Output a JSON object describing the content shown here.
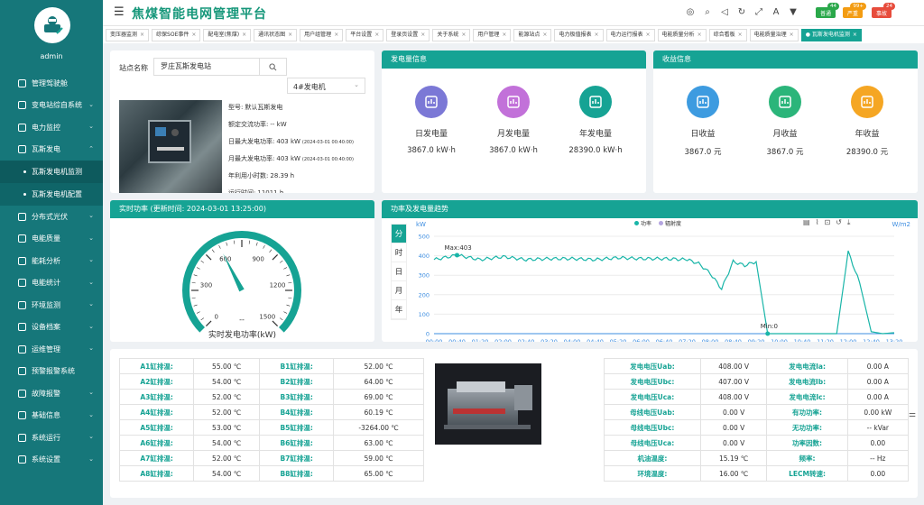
{
  "app": {
    "title": "焦煤智能电网管理平台",
    "user": "admin"
  },
  "sidebar": {
    "items": [
      {
        "label": "管理驾驶舱",
        "icon": "monitor-icon",
        "arrow": false
      },
      {
        "label": "变电站综自系统",
        "icon": "house-icon",
        "arrow": true
      },
      {
        "label": "电力监控",
        "icon": "gauge-icon",
        "arrow": true
      },
      {
        "label": "瓦斯发电",
        "icon": "gas-icon",
        "arrow": true,
        "open": true
      },
      {
        "label": "分布式光伏",
        "icon": "solar-icon",
        "arrow": true
      },
      {
        "label": "电能质量",
        "icon": "quality-icon",
        "arrow": true
      },
      {
        "label": "能耗分析",
        "icon": "chart-icon",
        "arrow": true
      },
      {
        "label": "电能统计",
        "icon": "stats-icon",
        "arrow": true
      },
      {
        "label": "环境监测",
        "icon": "env-icon",
        "arrow": true
      },
      {
        "label": "设备档案",
        "icon": "archive-icon",
        "arrow": true
      },
      {
        "label": "运维管理",
        "icon": "tools-icon",
        "arrow": true
      },
      {
        "label": "预警报警系统",
        "icon": "alarm-icon",
        "arrow": false
      },
      {
        "label": "故障报警",
        "icon": "fault-icon",
        "arrow": true
      },
      {
        "label": "基础信息",
        "icon": "info-icon",
        "arrow": true
      },
      {
        "label": "系统运行",
        "icon": "run-icon",
        "arrow": true
      },
      {
        "label": "系统设置",
        "icon": "settings-icon",
        "arrow": true
      }
    ],
    "sub_items": [
      {
        "label": "瓦斯发电机监测"
      },
      {
        "label": "瓦斯发电机配置"
      }
    ]
  },
  "topbar": {
    "icons": [
      "lifebuoy-icon",
      "search-icon",
      "volume-icon",
      "refresh-icon",
      "fullscreen-icon",
      "font-icon",
      "shirt-icon"
    ],
    "badges": [
      {
        "label": "普通",
        "count": "44",
        "color": "#2aa84a"
      },
      {
        "label": "严重",
        "count": "99+",
        "color": "#f39c12"
      },
      {
        "label": "事故",
        "count": "24",
        "color": "#e74c3c"
      }
    ]
  },
  "tabs": [
    "变压器监测",
    "综保SOE事件",
    "配电室(焦煤)",
    "通讯状态图",
    "用户组管理",
    "平台设置",
    "登录页设置",
    "关于系统",
    "用户管理",
    "能源站点",
    "电力极值报表",
    "电力运行报表",
    "电能质量分析",
    "综合看板",
    "电能质量治理",
    "瓦斯发电机监测"
  ],
  "station": {
    "label": "站点名称",
    "value": "罗庄瓦斯发电站",
    "generator": "4#发电机",
    "info": [
      {
        "k": "型号:",
        "v": "默认瓦斯发电"
      },
      {
        "k": "额定交流功率:",
        "v": "-- kW"
      },
      {
        "k": "日最大发电功率:",
        "v": "403 kW",
        "t": "(2024-03-01 00:40:00)"
      },
      {
        "k": "月最大发电功率:",
        "v": "403 kW",
        "t": "(2024-03-01 00:40:00)"
      },
      {
        "k": "年利用小时数:",
        "v": "28.39 h"
      },
      {
        "k": "运行时间:",
        "v": "11011 h"
      }
    ]
  },
  "generation": {
    "title": "发电量信息",
    "items": [
      {
        "label": "日发电量",
        "value": "3867.0 kW·h",
        "color": "#7b78d6"
      },
      {
        "label": "月发电量",
        "value": "3867.0 kW·h",
        "color": "#c271d9"
      },
      {
        "label": "年发电量",
        "value": "28390.0 kW·h",
        "color": "#16a394"
      }
    ]
  },
  "income": {
    "title": "收益信息",
    "items": [
      {
        "label": "日收益",
        "value": "3867.0 元",
        "color": "#3d9be0"
      },
      {
        "label": "月收益",
        "value": "3867.0 元",
        "color": "#2bb57a"
      },
      {
        "label": "年收益",
        "value": "28390.0 元",
        "color": "#f5a623"
      }
    ]
  },
  "realtime": {
    "title": "实时功率 (更新时间: 2024-03-01 13:25:00)",
    "gauge_label": "实时发电功率(kW)",
    "value_text": "--",
    "value": 600,
    "ticks": [
      "0",
      "300",
      "600",
      "900",
      "1200",
      "1500"
    ]
  },
  "trend": {
    "title": "功率及发电量趋势",
    "periods": [
      "分",
      "时",
      "日",
      "月",
      "年"
    ],
    "active_period": 0,
    "ylabel_left": "kW",
    "ylabel_right": "W/m2",
    "legend": [
      "功率",
      "辐射度"
    ],
    "max_label": "Max:403",
    "min_label": "Min:0",
    "x_ticks": [
      "00:00",
      "00:40",
      "01:20",
      "02:00",
      "02:40",
      "03:20",
      "04:00",
      "04:40",
      "05:20",
      "06:00",
      "06:40",
      "07:20",
      "08:00",
      "08:40",
      "09:20",
      "10:00",
      "10:40",
      "11:20",
      "12:00",
      "12:40",
      "13:20"
    ],
    "y_ticks": [
      "0",
      "100",
      "200",
      "300",
      "400",
      "500"
    ]
  },
  "chart_data": {
    "type": "line",
    "title": "功率及发电量趋势",
    "ylabel": "kW",
    "ylim": [
      0,
      500
    ],
    "x": [
      "00:00",
      "00:40",
      "01:20",
      "02:00",
      "02:40",
      "03:20",
      "04:00",
      "04:40",
      "05:20",
      "06:00",
      "06:40",
      "07:20",
      "07:40",
      "08:00",
      "08:20",
      "08:40",
      "09:00",
      "09:20",
      "09:40",
      "10:00",
      "10:40",
      "11:20",
      "11:40",
      "12:00",
      "12:20",
      "12:40",
      "13:00",
      "13:20"
    ],
    "series": [
      {
        "name": "功率",
        "values": [
          380,
          403,
          380,
          395,
          380,
          385,
          385,
          380,
          390,
          385,
          385,
          380,
          360,
          310,
          230,
          370,
          350,
          370,
          0,
          0,
          0,
          0,
          0,
          420,
          260,
          10,
          0,
          5
        ]
      }
    ]
  },
  "temps": {
    "rows": [
      [
        "A1缸排温:",
        "55.00 ℃",
        "B1缸排温:",
        "52.00 ℃"
      ],
      [
        "A2缸排温:",
        "54.00 ℃",
        "B2缸排温:",
        "64.00 ℃"
      ],
      [
        "A3缸排温:",
        "52.00 ℃",
        "B3缸排温:",
        "69.00 ℃"
      ],
      [
        "A4缸排温:",
        "52.00 ℃",
        "B4缸排温:",
        "60.19 ℃"
      ],
      [
        "A5缸排温:",
        "53.00 ℃",
        "B5缸排温:",
        "-3264.00 ℃"
      ],
      [
        "A6缸排温:",
        "54.00 ℃",
        "B6缸排温:",
        "63.00 ℃"
      ],
      [
        "A7缸排温:",
        "52.00 ℃",
        "B7缸排温:",
        "59.00 ℃"
      ],
      [
        "A8缸排温:",
        "54.00 ℃",
        "B8缸排温:",
        "65.00 ℃"
      ]
    ]
  },
  "electrical": {
    "rows": [
      [
        "发电电压Uab:",
        "408.00 V",
        "发电电流Ia:",
        "0.00 A"
      ],
      [
        "发电电压Ubc:",
        "407.00 V",
        "发电电流Ib:",
        "0.00 A"
      ],
      [
        "发电电压Uca:",
        "408.00 V",
        "发电电流Ic:",
        "0.00 A"
      ],
      [
        "母线电压Uab:",
        "0.00 V",
        "有功功率:",
        "0.00 kW"
      ],
      [
        "母线电压Ubc:",
        "0.00 V",
        "无功功率:",
        "-- kVar"
      ],
      [
        "母线电压Uca:",
        "0.00 V",
        "功率因数:",
        "0.00"
      ],
      [
        "机油温度:",
        "15.19 ℃",
        "频率:",
        "-- Hz"
      ],
      [
        "环境温度:",
        "16.00 ℃",
        "LECM转速:",
        "0.00"
      ]
    ]
  }
}
